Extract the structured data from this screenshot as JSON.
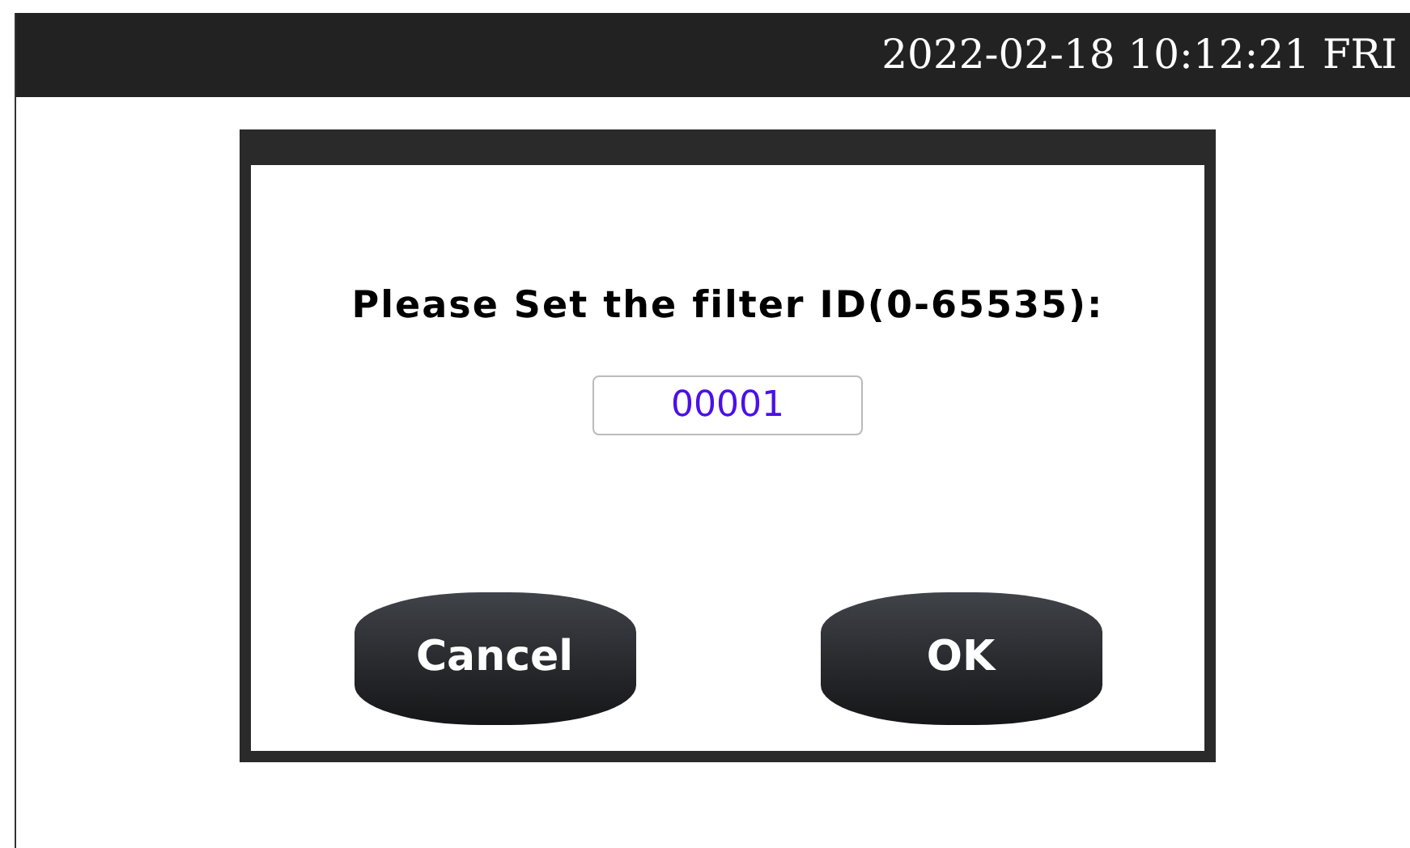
{
  "status_bar": {
    "datetime": "2022-02-18 10:12:21 FRI"
  },
  "dialog": {
    "prompt": "Please Set the filter ID(0-65535):",
    "field": {
      "value": "00001"
    },
    "buttons": [
      "Cancel",
      "OK"
    ]
  }
}
